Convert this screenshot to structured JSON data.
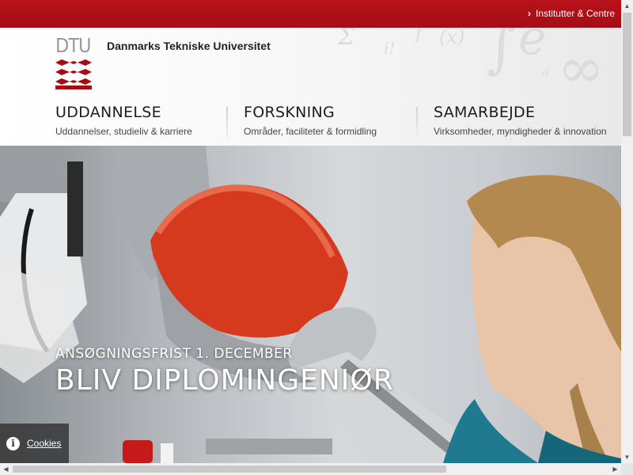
{
  "topbar": {
    "link_label": "Institutter & Centre",
    "link_icon": "chevron-right-icon",
    "color": "#b0101a"
  },
  "header": {
    "logo_text": "DTU",
    "university_name": "Danmarks Tekniske Universitet",
    "nav": [
      {
        "title": "UDDANNELSE",
        "subtitle": "Uddannelser, studieliv & karriere"
      },
      {
        "title": "FORSKNING",
        "subtitle": "Områder, faciliteter & formidling"
      },
      {
        "title": "SAMARBEJDE",
        "subtitle": "Virksomheder, myndigheder & innovation"
      }
    ]
  },
  "hero": {
    "kicker": "ANSØGNINGSFRIST 1. DECEMBER",
    "headline": "BLIV DIPLOMINGENIØR"
  },
  "cookies": {
    "label": "Cookies",
    "icon": "info-icon"
  },
  "colors": {
    "brand_red": "#a50d15",
    "robot_orange": "#d63a1e"
  }
}
